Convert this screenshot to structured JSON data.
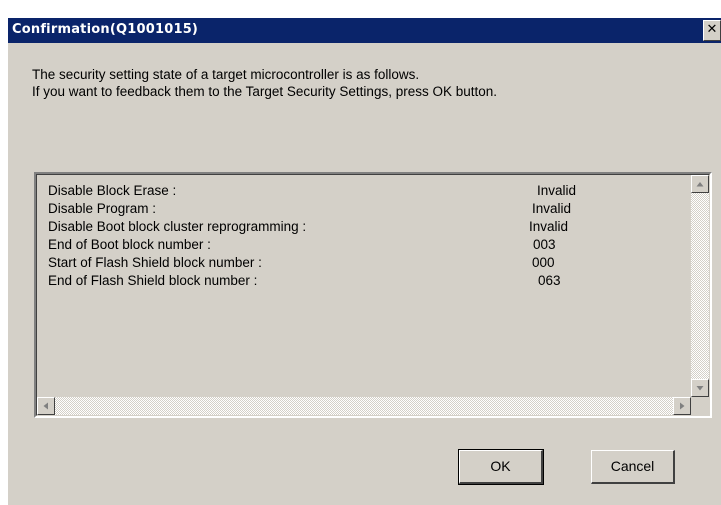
{
  "window": {
    "title": "Confirmation(Q1001015)",
    "close_glyph": "✕"
  },
  "message": {
    "line1": "The security setting state of a target microcontroller is as follows.",
    "line2": "If you want to feedback them to the Target Security Settings, press OK button."
  },
  "settings": {
    "items": [
      {
        "label": "Disable Block Erase :",
        "value": "Invalid"
      },
      {
        "label": "Disable Program :",
        "value": "Invalid"
      },
      {
        "label": "Disable Boot block cluster reprogramming :",
        "value": "Invalid"
      },
      {
        "label": "End of Boot block number :",
        "value": "003"
      },
      {
        "label": "Start of Flash Shield block number :",
        "value": "000"
      },
      {
        "label": "End of Flash Shield block number :",
        "value": "063"
      }
    ]
  },
  "buttons": {
    "ok_label": "OK",
    "cancel_label": "Cancel"
  },
  "icons": {
    "scroll_up": "scroll-up-arrow-icon",
    "scroll_down": "scroll-down-arrow-icon",
    "scroll_left": "scroll-left-arrow-icon",
    "scroll_right": "scroll-right-arrow-icon"
  },
  "colors": {
    "titlebar": "#0a246a",
    "face": "#d4d0c8"
  }
}
